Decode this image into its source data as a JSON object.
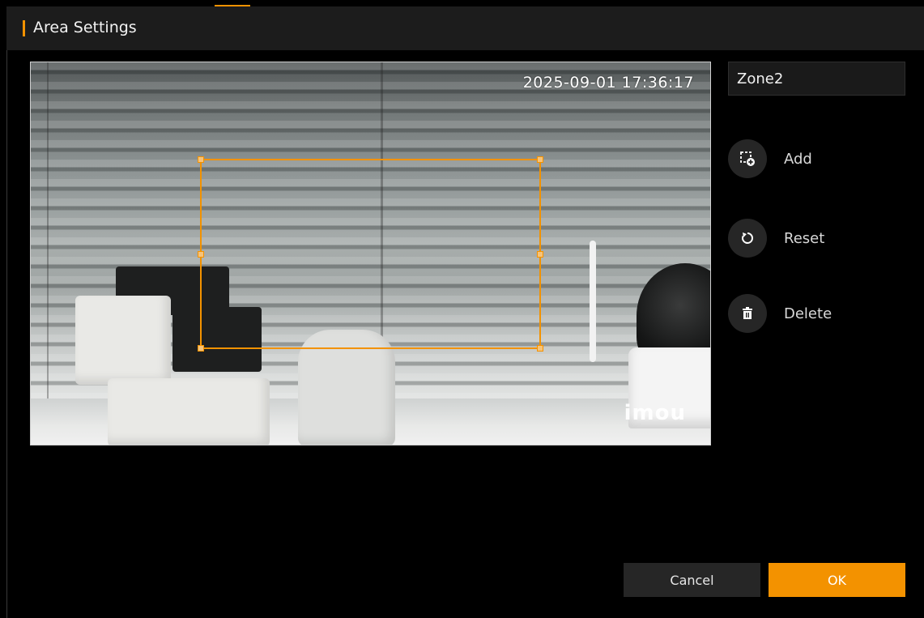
{
  "dialog": {
    "title": "Area Settings"
  },
  "preview": {
    "timestamp": "2025-09-01 17:36:17",
    "watermark": "imou"
  },
  "zone": {
    "name_value": "Zone2"
  },
  "actions": [
    {
      "label": "Add",
      "icon": "add-area-icon"
    },
    {
      "label": "Reset",
      "icon": "reset-icon"
    },
    {
      "label": "Delete",
      "icon": "trash-icon"
    }
  ],
  "footer": {
    "cancel_label": "Cancel",
    "ok_label": "OK"
  },
  "colors": {
    "accent": "#f39200",
    "background": "#000000",
    "header": "#1c1c1c",
    "button_dark": "#262626"
  }
}
